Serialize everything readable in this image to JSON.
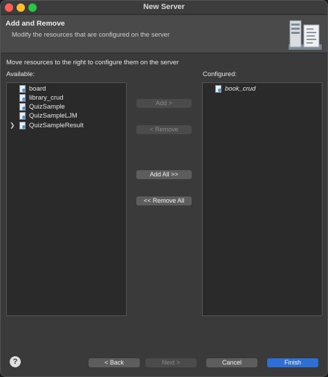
{
  "window": {
    "title": "New Server"
  },
  "banner": {
    "title": "Add and Remove",
    "description": "Modify the resources that are configured on the server"
  },
  "instruction": "Move resources to the right to configure them on the server",
  "available": {
    "label": "Available:",
    "items": [
      {
        "label": "board",
        "expandable": false
      },
      {
        "label": "library_crud",
        "expandable": false
      },
      {
        "label": "QuizSample",
        "expandable": false
      },
      {
        "label": "QuizSampleLJM",
        "expandable": false
      },
      {
        "label": "QuizSampleResult",
        "expandable": true
      }
    ]
  },
  "configured": {
    "label": "Configured:",
    "items": [
      {
        "label": "book_crud"
      }
    ]
  },
  "buttons": {
    "add": "Add >",
    "remove": "< Remove",
    "add_all": "Add All >>",
    "remove_all": "<< Remove All",
    "back": "< Back",
    "next": "Next >",
    "cancel": "Cancel",
    "finish": "Finish"
  },
  "help_icon": "?",
  "colors": {
    "accent": "#2e6fd6",
    "close": "#ff5f57",
    "minimize": "#febc2e",
    "maximize": "#28c840"
  }
}
